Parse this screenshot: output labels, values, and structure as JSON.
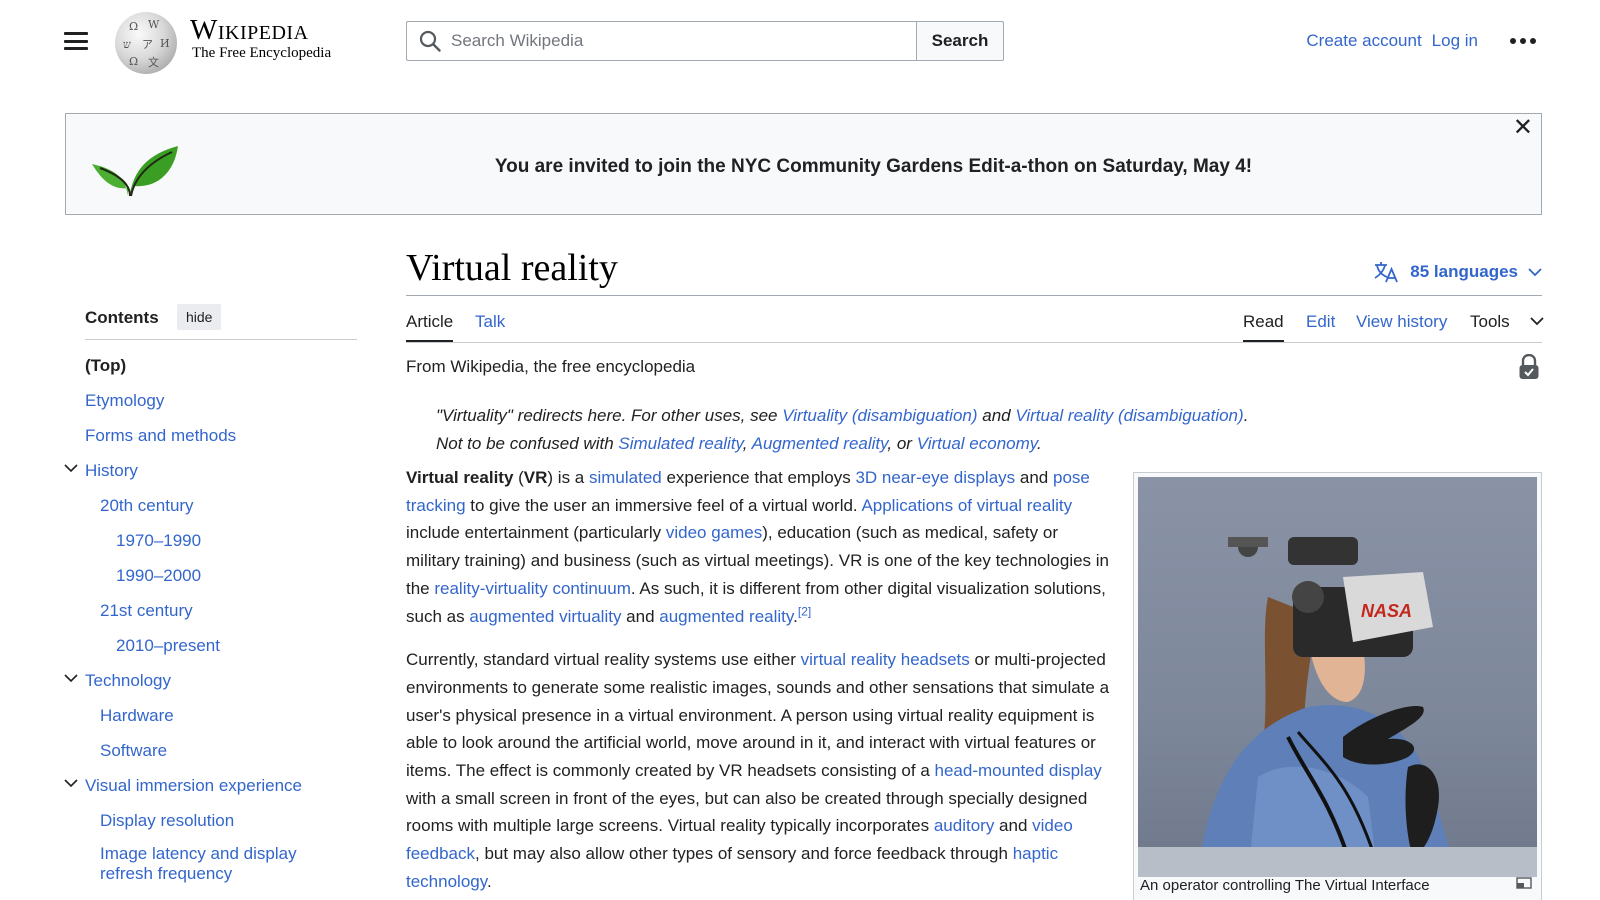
{
  "header": {
    "wordmark": "Wikipedia",
    "tagline": "The Free Encyclopedia",
    "search_placeholder": "Search Wikipedia",
    "search_button": "Search",
    "create_account": "Create account",
    "log_in": "Log in"
  },
  "banner": {
    "text": "You are invited to join the NYC Community Gardens Edit-a-thon on Saturday, May 4!"
  },
  "toc": {
    "heading": "Contents",
    "hide_label": "hide",
    "items": [
      {
        "label": "(Top)"
      },
      {
        "label": "Etymology"
      },
      {
        "label": "Forms and methods"
      },
      {
        "label": "History"
      },
      {
        "label": "20th century"
      },
      {
        "label": "1970–1990"
      },
      {
        "label": "1990–2000"
      },
      {
        "label": "21st century"
      },
      {
        "label": "2010–present"
      },
      {
        "label": "Technology"
      },
      {
        "label": "Hardware"
      },
      {
        "label": "Software"
      },
      {
        "label": "Visual immersion experience"
      },
      {
        "label": "Display resolution"
      },
      {
        "label": "Image latency and display refresh frequency"
      }
    ]
  },
  "article": {
    "title": "Virtual reality",
    "languages": "85 languages",
    "tabs": {
      "article": "Article",
      "talk": "Talk",
      "read": "Read",
      "edit": "Edit",
      "view_history": "View history",
      "tools": "Tools"
    },
    "from": "From Wikipedia, the free encyclopedia",
    "hatnote": {
      "l1a": "\"Virtuality\" redirects here. For other uses, see ",
      "l1b": "Virtuality (disambiguation)",
      "l1c": " and ",
      "l1d": "Virtual reality (disambiguation)",
      "l1e": ".",
      "l2a": "Not to be confused with ",
      "l2b": "Simulated reality",
      "l2c": ", ",
      "l2d": "Augmented reality",
      "l2e": ", or ",
      "l2f": "Virtual economy",
      "l2g": "."
    },
    "p1": {
      "s1": "Virtual reality",
      "s2": " (",
      "s3": "VR",
      "s4": ") is a ",
      "s5": "simulated",
      "s6": " experience that employs ",
      "s7": "3D near-eye displays",
      "s8": " and ",
      "s9": "pose tracking",
      "s10": " to give the user an immersive feel of a virtual world. ",
      "s11": "Applications of virtual reality",
      "s12": " include entertainment (particularly ",
      "s13": "video games",
      "s14": "), education (such as medical, safety or military training) and business (such as virtual meetings). VR is one of the key technologies in the ",
      "s15": "reality-virtuality continuum",
      "s16": ". As such, it is different from other digital visualization solutions, such as ",
      "s17": "augmented virtuality",
      "s18": " and ",
      "s19": "augmented reality",
      "s20": ".",
      "s21": "[2]"
    },
    "p2": {
      "s1": "Currently, standard virtual reality systems use either ",
      "s2": "virtual reality headsets",
      "s3": " or multi-projected environments to generate some realistic images, sounds and other sensations that simulate a user's physical presence in a virtual environment. A person using virtual reality equipment is able to look around the artificial world, move around in it, and interact with virtual features or items. The effect is commonly created by VR headsets consisting of a ",
      "s4": "head-mounted display",
      "s5": " with a small screen in front of the eyes, but can also be created through specially designed rooms with multiple large screens. Virtual reality typically incorporates ",
      "s6": "auditory",
      "s7": " and ",
      "s8": "video feedback",
      "s9": ", but may also allow other types of sensory and force feedback through ",
      "s10": "haptic technology",
      "s11": "."
    },
    "image": {
      "headset_label": "NASA",
      "caption": "An operator controlling The Virtual Interface"
    }
  },
  "colors": {
    "link": "#3366cc",
    "text": "#202122",
    "border": "#a2a9b1",
    "leaf": "#4caf32"
  }
}
